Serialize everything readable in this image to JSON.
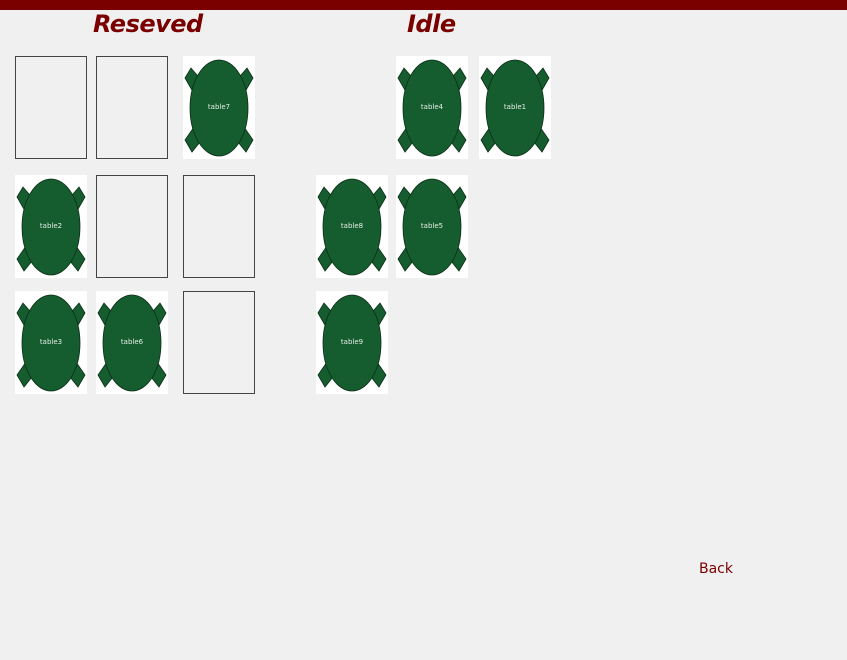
{
  "headings": {
    "reserved": "Reseved",
    "idle": "Idle"
  },
  "tables": {
    "t1": "table1",
    "t2": "table2",
    "t3": "table3",
    "t4": "table4",
    "t5": "table5",
    "t6": "table6",
    "t7": "table7",
    "t8": "table8",
    "t9": "table9"
  },
  "back_label": "Back",
  "colors": {
    "accent": "#7a0000",
    "table_fill": "#155c2e",
    "background": "#f0f0f0"
  }
}
